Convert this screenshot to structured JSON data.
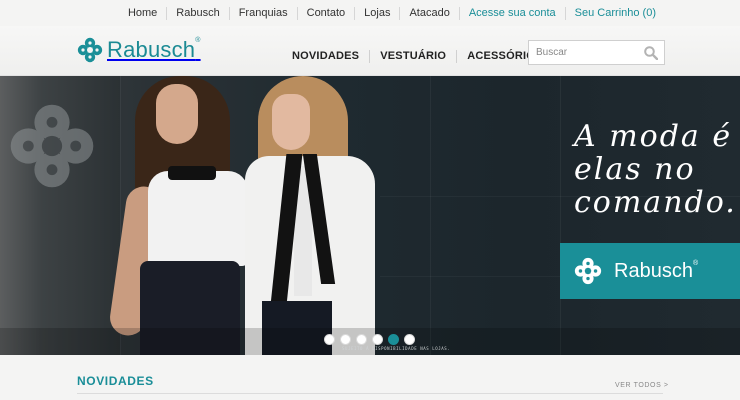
{
  "top_links": [
    "Home",
    "Rabusch",
    "Franquias",
    "Contato",
    "Lojas",
    "Atacado",
    "Acesse sua conta"
  ],
  "cart_label": "Seu Carrinho (0)",
  "logo": {
    "text": "Rabusch",
    "mark": "®"
  },
  "main_nav": [
    "NOVIDADES",
    "VESTUÁRIO",
    "ACESSÓRIOS"
  ],
  "search": {
    "placeholder": "Buscar",
    "icon": "search-icon"
  },
  "hero": {
    "headline": [
      "A moda é",
      "elas no",
      "comando."
    ],
    "brand_box_text": "Rabusch",
    "disclaimer": "SUJEITO À DISPONIBILIDADE NAS LOJAS.",
    "slider_dots": 6,
    "active_dot": 5
  },
  "section": {
    "title": "NOVIDADES",
    "see_all": "VER TODOS >"
  },
  "colors": {
    "accent": "#1a8f98",
    "text": "#333333",
    "background": "#f4f4f3"
  }
}
